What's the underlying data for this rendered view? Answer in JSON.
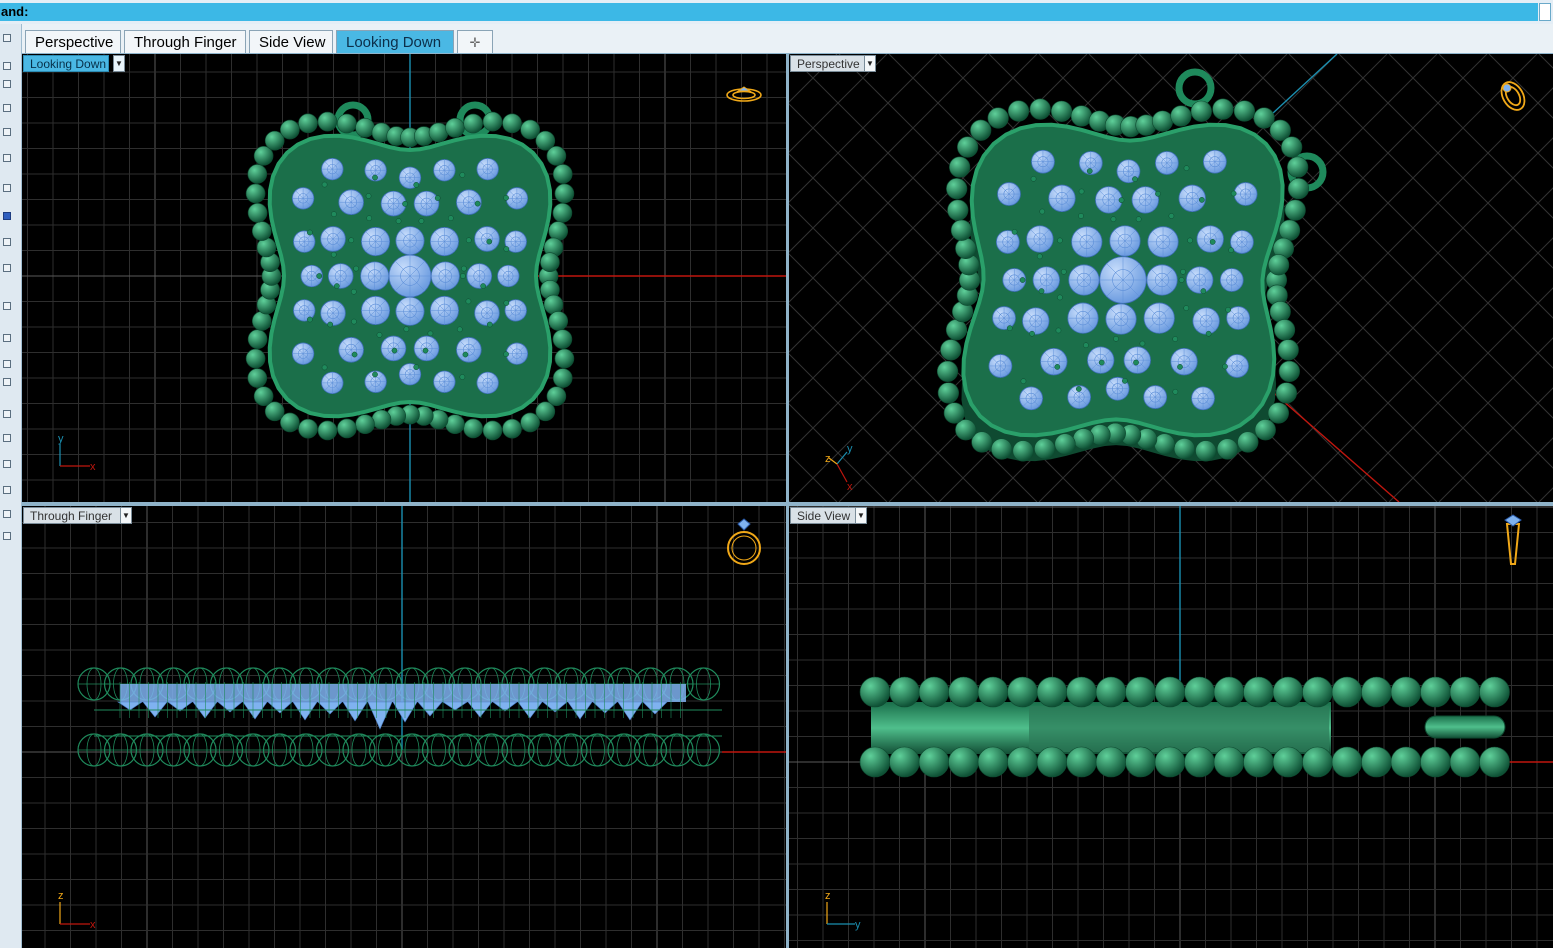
{
  "command": {
    "label": "and:"
  },
  "tabs": [
    {
      "label": "Perspective",
      "active": false
    },
    {
      "label": "Through Finger",
      "active": false
    },
    {
      "label": "Side View",
      "active": false
    },
    {
      "label": "Looking Down",
      "active": true
    }
  ],
  "add_tab_icon": "plus-icon",
  "viewports": {
    "top_left": {
      "title": "Looking Down",
      "active": true,
      "axis_v": "y",
      "axis_h": "x",
      "nav_icon": "ring-flat-icon"
    },
    "top_right": {
      "title": "Perspective",
      "active": false,
      "axis_z": "z",
      "axis_y": "y",
      "axis_x": "x",
      "nav_icon": "ring-perspective-icon"
    },
    "bottom_left": {
      "title": "Through Finger",
      "active": false,
      "axis_v": "z",
      "axis_h": "x",
      "nav_icon": "ring-front-icon"
    },
    "bottom_right": {
      "title": "Side View",
      "active": false,
      "axis_v": "z",
      "axis_h": "y",
      "nav_icon": "ring-side-icon"
    }
  },
  "colors": {
    "active_tab": "#4ab8e4",
    "metal": "#1f8a5c",
    "gem": "#7fb2f0",
    "grid": "#3a3a3a",
    "x_axis": "#c0160e",
    "y_axis": "#1b8fb0",
    "nav_icon": "#f0a818"
  }
}
